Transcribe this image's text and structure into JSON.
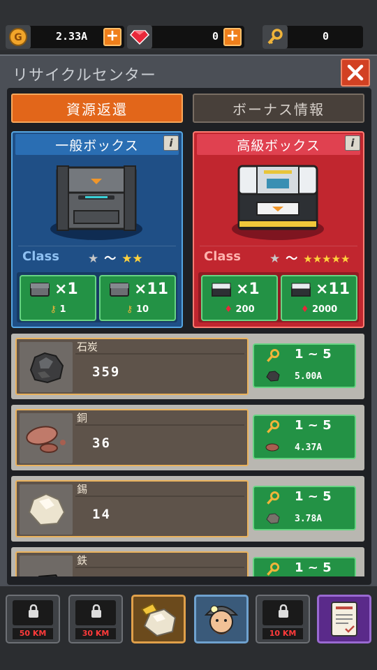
{
  "currency": {
    "gold": {
      "icon": "gold-coin-icon",
      "value": "2.33A"
    },
    "gem": {
      "icon": "red-gem-icon",
      "value": "0"
    },
    "key": {
      "icon": "key-icon",
      "value": "0"
    },
    "plus": "+"
  },
  "panel": {
    "title": "リサイクルセンター",
    "close": "✕"
  },
  "tabs": [
    {
      "label": "資源返還",
      "active": true
    },
    {
      "label": "ボーナス情報",
      "active": false
    }
  ],
  "boxes": {
    "normal": {
      "title": "一般ボックス",
      "info": "i",
      "class_label": "Class",
      "stars_min": "★",
      "tilde": "〜",
      "stars_max": "★★",
      "buy": [
        {
          "qty": "×1",
          "cost": "1",
          "cost_icon": "key-icon"
        },
        {
          "qty": "×11",
          "cost": "10",
          "cost_icon": "key-icon"
        }
      ]
    },
    "premium": {
      "title": "高級ボックス",
      "info": "i",
      "class_label": "Class",
      "stars_min": "★",
      "tilde": "〜",
      "stars_max": "★★★★★",
      "buy": [
        {
          "qty": "×1",
          "cost": "200",
          "cost_icon": "red-gem-icon"
        },
        {
          "qty": "×11",
          "cost": "2000",
          "cost_icon": "red-gem-icon"
        }
      ]
    }
  },
  "resources": [
    {
      "name": "石炭",
      "count": "359",
      "range": "1 ~ 5",
      "amount": "5.00A",
      "icon": "coal-icon"
    },
    {
      "name": "銅",
      "count": "36",
      "range": "1 ~ 5",
      "amount": "4.37A",
      "icon": "copper-ore-icon"
    },
    {
      "name": "錫",
      "count": "14",
      "range": "1 ~ 5",
      "amount": "3.78A",
      "icon": "tin-ore-icon"
    },
    {
      "name": "鉄",
      "count": "",
      "range": "1 ~ 5",
      "amount": "",
      "icon": "iron-ore-icon"
    }
  ],
  "nav": [
    {
      "type": "locked",
      "label": "50 KM"
    },
    {
      "type": "locked",
      "label": "30 KM"
    },
    {
      "type": "ore",
      "icon": "ore-icon"
    },
    {
      "type": "miner",
      "icon": "miner-icon"
    },
    {
      "type": "locked",
      "label": "10 KM"
    },
    {
      "type": "document",
      "icon": "document-icon"
    }
  ]
}
